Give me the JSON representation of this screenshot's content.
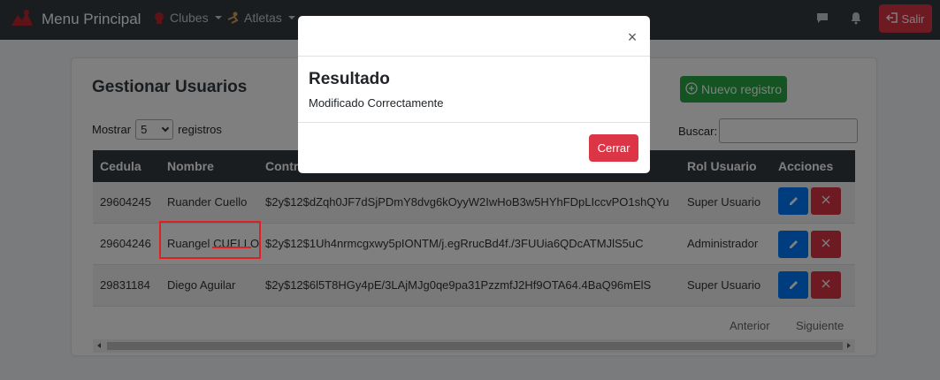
{
  "navbar": {
    "brand": "Menu Principal",
    "clubes": "Clubes",
    "atletas": "Atletas",
    "salir": "Salir"
  },
  "card": {
    "title": "Gestionar Usuarios",
    "new_button": "Nuevo registro",
    "show_prefix": "Mostrar",
    "show_value": "5",
    "show_suffix": "registros",
    "search_label": "Buscar:"
  },
  "table": {
    "headers": [
      "Cedula",
      "Nombre",
      "Contra",
      "Rol Usuario",
      "Acciones"
    ],
    "rows": [
      {
        "cedula": "29604245",
        "nombre": "Ruander Cuello",
        "contra": "$2y$12$dZqh0JF7dSjPDmY8dvg6kOyyW2IwHoB3w5HYhFDpLIccvPO1shQYu",
        "rol": "Super Usuario"
      },
      {
        "cedula": "29604246",
        "nombre_first": "Ruangel",
        "nombre_last": "CUELLO",
        "contra": "$2y$12$1Uh4nrmcgxwy5pIONTM/j.egRrucBd4f./3FUUia6QDcATMJlS5uC",
        "rol": "Administrador"
      },
      {
        "cedula": "29831184",
        "nombre": "Diego Aguilar",
        "contra": "$2y$12$6l5T8HGy4pE/3LAjMJg0qe9pa31PzzmfJ2Hf9OTA64.4BaQ96mElS",
        "rol": "Super Usuario"
      }
    ]
  },
  "pager": {
    "prev": "Anterior",
    "next": "Siguiente"
  },
  "modal": {
    "close_glyph": "×",
    "title": "Resultado",
    "message": "Modificado Correctamente",
    "cerrar": "Cerrar"
  },
  "colors": {
    "navbar": "#343a40",
    "success": "#28a745",
    "danger": "#dc3545",
    "primary": "#007bff"
  }
}
